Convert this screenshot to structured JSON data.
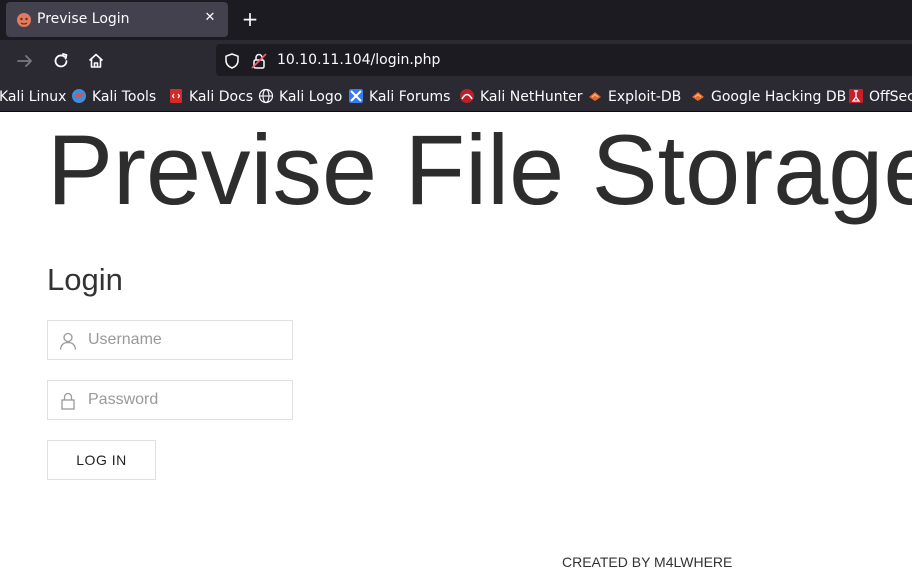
{
  "browser": {
    "tab": {
      "title": "Previse Login",
      "close_glyph": "✕"
    },
    "new_tab_glyph": "+",
    "url": "10.10.11.104/login.php",
    "bookmarks": [
      {
        "label": "Kali Linux",
        "icon": "kali-icon"
      },
      {
        "label": "Kali Tools",
        "icon": "kali-tools-icon"
      },
      {
        "label": "Kali Docs",
        "icon": "kali-docs-icon"
      },
      {
        "label": "Kali Logo",
        "icon": "globe-icon"
      },
      {
        "label": "Kali Forums",
        "icon": "kali-forums-icon"
      },
      {
        "label": "Kali NetHunter",
        "icon": "nethunter-icon"
      },
      {
        "label": "Exploit-DB",
        "icon": "exploit-db-icon"
      },
      {
        "label": "Google Hacking DB",
        "icon": "exploit-db-icon"
      },
      {
        "label": "OffSec",
        "icon": "offsec-icon"
      }
    ]
  },
  "page": {
    "site_title": "Previse File Storage",
    "login_heading": "Login",
    "username_placeholder": "Username",
    "password_placeholder": "Password",
    "login_button": "LOG IN",
    "footer": "CREATED BY M4LWHERE"
  }
}
